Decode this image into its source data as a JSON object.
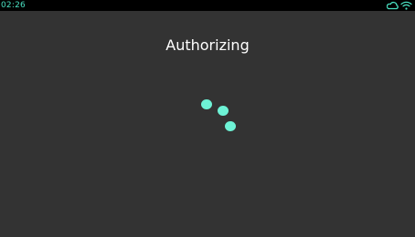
{
  "status_bar": {
    "time": "02:26",
    "icons": [
      "cloud-icon",
      "wifi-icon"
    ]
  },
  "main": {
    "title": "Authorizing"
  },
  "colors": {
    "accent": "#49e0c1",
    "background": "#333333",
    "status_bar_background": "#000000",
    "title_text": "#ffffff",
    "spinner_dot": "#6ef3d6"
  }
}
